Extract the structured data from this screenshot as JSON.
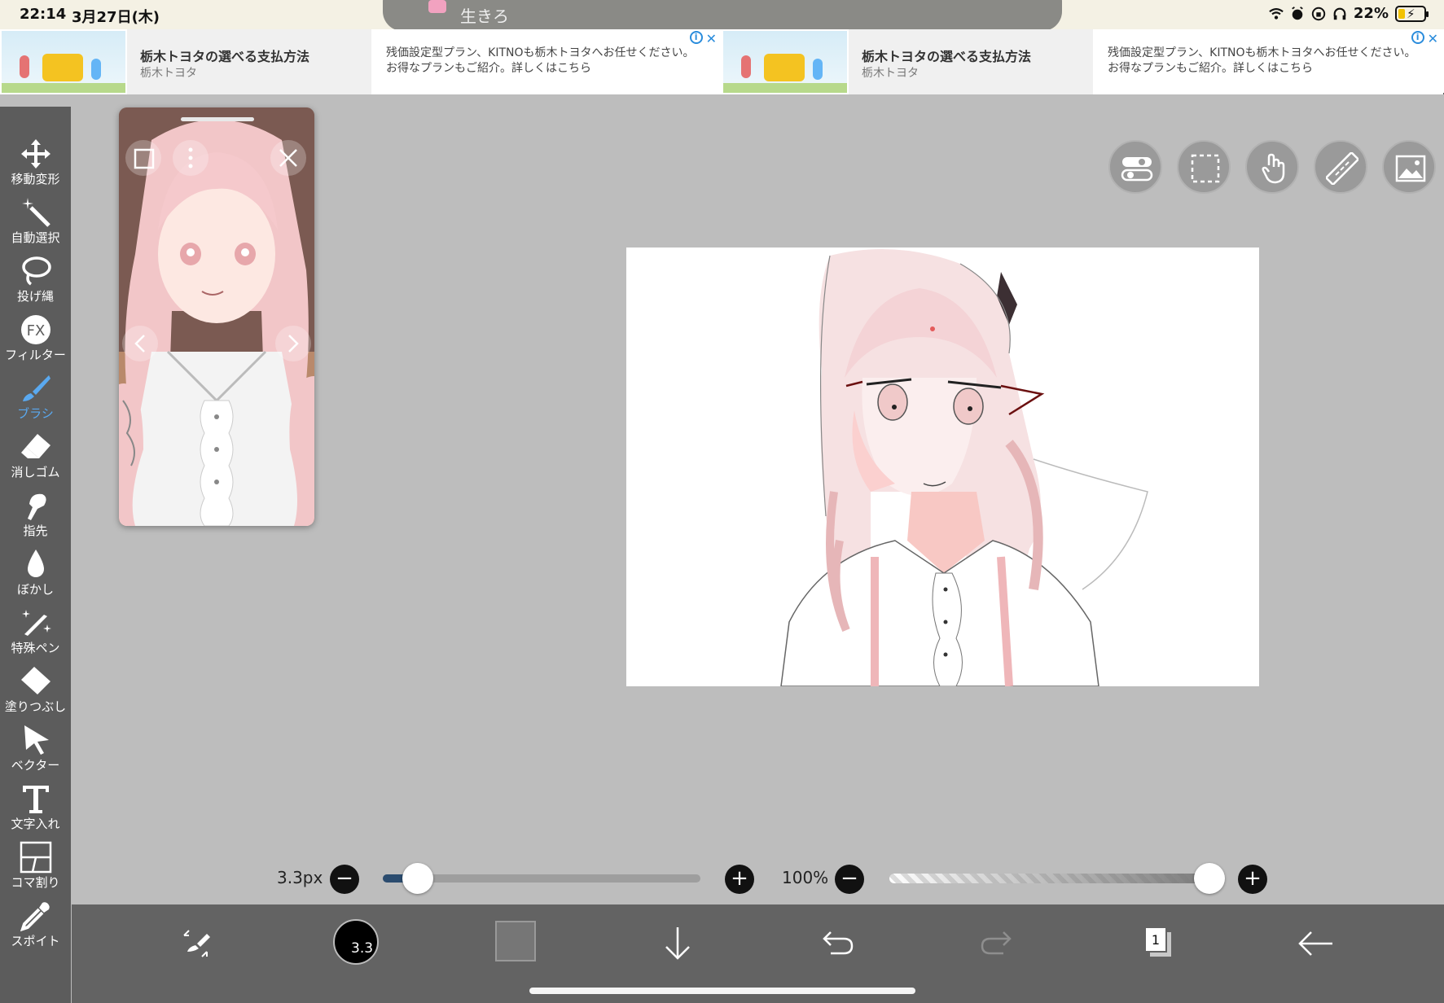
{
  "status": {
    "time": "22:14",
    "date": "3月27日(木)",
    "battery": "22%"
  },
  "notification": {
    "text": "生きろ"
  },
  "ads": [
    {
      "title": "栃木トヨタの選べる支払方法",
      "sub": "栃木トヨタ",
      "body": "残価設定型プラン、KITNOも栃木トヨタへお任せください。お得なプランもご紹介。詳しくはこちら"
    },
    {
      "title": "栃木トヨタの選べる支払方法",
      "sub": "栃木トヨタ",
      "body": "残価設定型プラン、KITNOも栃木トヨタへお任せください。お得なプランもご紹介。詳しくはこちら"
    }
  ],
  "toolbar": {
    "items": [
      {
        "label": "移動変形",
        "icon": "move-icon"
      },
      {
        "label": "自動選択",
        "icon": "magic-wand-icon"
      },
      {
        "label": "投げ縄",
        "icon": "lasso-icon"
      },
      {
        "label": "フィルター",
        "icon": "fx-icon"
      },
      {
        "label": "ブラシ",
        "icon": "brush-icon"
      },
      {
        "label": "消しゴム",
        "icon": "eraser-icon"
      },
      {
        "label": "指先",
        "icon": "finger-icon"
      },
      {
        "label": "ぼかし",
        "icon": "blur-drop-icon"
      },
      {
        "label": "特殊ペン",
        "icon": "special-pen-icon"
      },
      {
        "label": "塗りつぶし",
        "icon": "fill-icon"
      },
      {
        "label": "ベクター",
        "icon": "vector-arrow-icon"
      },
      {
        "label": "文字入れ",
        "icon": "text-icon"
      },
      {
        "label": "コマ割り",
        "icon": "frame-divider-icon"
      },
      {
        "label": "スポイト",
        "icon": "eyedropper-icon"
      }
    ],
    "active": "ブラシ"
  },
  "sliders": {
    "size_label": "3.3px",
    "size_value": 3.3,
    "opacity_label": "100%",
    "opacity_value": 100
  },
  "bottombar": {
    "brush_size": "3.3",
    "layer_count": "1",
    "color": "#767676"
  },
  "colors": {
    "toolbar_bg": "#5c5c5c",
    "workspace_bg": "#bdbdbd",
    "bottombar_bg": "#636363",
    "active_tool": "#5aa9f0"
  }
}
